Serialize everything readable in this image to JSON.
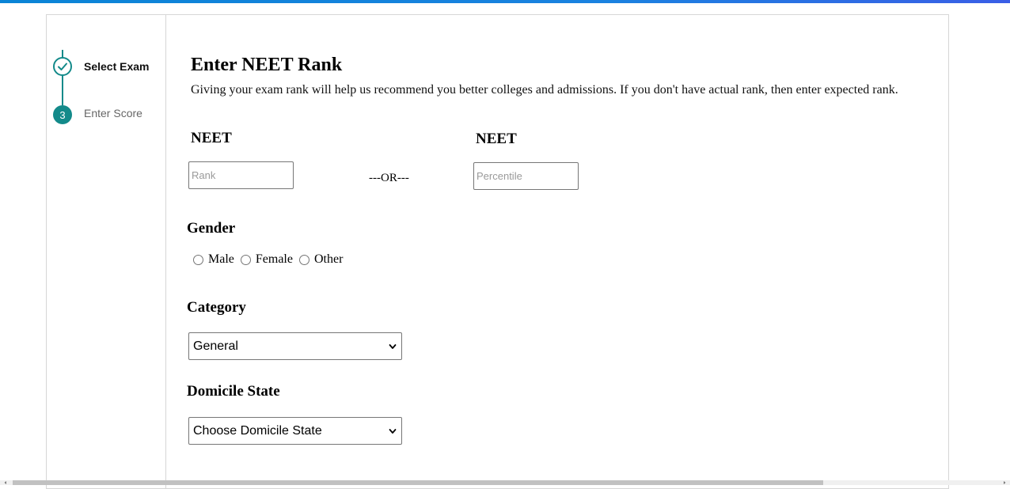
{
  "sidebar": {
    "steps": [
      {
        "label": "Select Exam",
        "state": "done"
      },
      {
        "number": "3",
        "label": "Enter Score",
        "state": "current"
      }
    ]
  },
  "main": {
    "title": "Enter NEET Rank",
    "description": "Giving your exam rank will help us recommend you better colleges and admissions. If you don't have actual rank, then enter expected rank.",
    "rank_section": {
      "left_label": "NEET",
      "rank_placeholder": "Rank",
      "or_text": "---OR---",
      "right_label": "NEET",
      "percentile_placeholder": "Percentile"
    },
    "gender": {
      "label": "Gender",
      "options": [
        "Male",
        "Female",
        "Other"
      ]
    },
    "category": {
      "label": "Category",
      "selected": "General"
    },
    "domicile": {
      "label": "Domicile State",
      "selected": "Choose Domicile State"
    }
  },
  "colors": {
    "accent": "#138a8a",
    "top_bar": "#1a82e0"
  }
}
